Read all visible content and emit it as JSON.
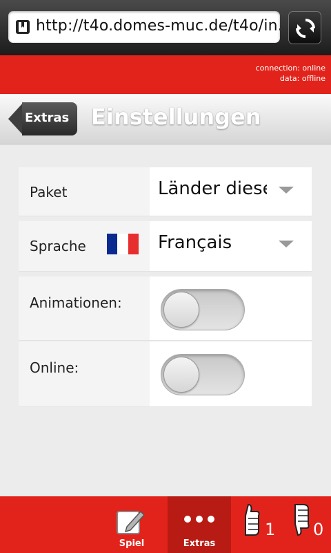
{
  "browser": {
    "url": "http://t4o.domes-muc.de/t4o/in..."
  },
  "status": {
    "connection": "connection: online",
    "data": "data: offline"
  },
  "header": {
    "back_label": "Extras",
    "title": "Einstellungen"
  },
  "settings": [
    {
      "label": "Paket",
      "value": "Länder diese"
    },
    {
      "label": "Sprache",
      "value": "Français"
    },
    {
      "label": "Animationen:",
      "on": false
    },
    {
      "label": "Online:",
      "on": false
    }
  ],
  "tabs": [
    {
      "label": "Spiel",
      "icon": "edit-icon"
    },
    {
      "label": "Extras",
      "icon": "more-icon"
    }
  ],
  "counters": {
    "thumbs_up": "1",
    "thumbs_down": "0"
  },
  "colors": {
    "brand_red": "#e2231b",
    "flag_blue": "#0b2a8f",
    "flag_white": "#ffffff",
    "flag_red": "#e62e2e"
  }
}
